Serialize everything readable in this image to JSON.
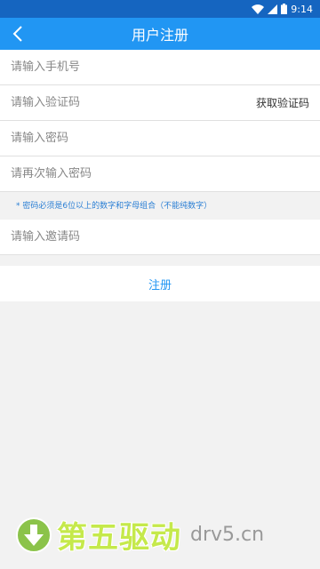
{
  "status": {
    "time": "9:14"
  },
  "header": {
    "title": "用户注册"
  },
  "form": {
    "phone_placeholder": "请输入手机号",
    "code_placeholder": "请输入验证码",
    "get_code_label": "获取验证码",
    "password_placeholder": "请输入密码",
    "password2_placeholder": "请再次输入密码",
    "hint": "* 密码必须是6位以上的数字和字母组合（不能纯数字）",
    "invite_placeholder": "请输入邀请码",
    "register_label": "注册"
  },
  "watermark": {
    "brand": "第五驱动",
    "domain": "drv5.cn"
  },
  "colors": {
    "statusbar": "#1565c0",
    "titlebar": "#2196f3",
    "accent": "#2196f3"
  }
}
